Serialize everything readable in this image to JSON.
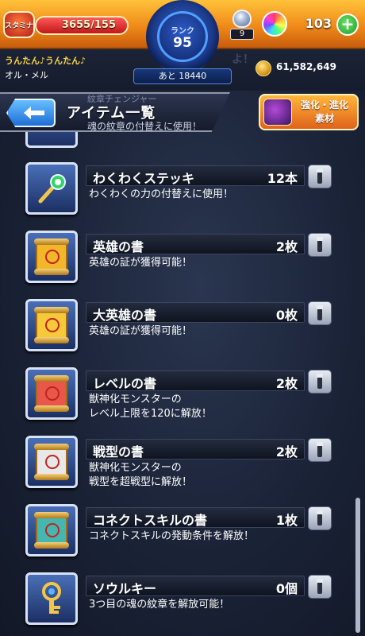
{
  "status": {
    "stamina_label": "スタミナ",
    "stamina_text": "3655/155",
    "stamina_fraction": 1.0,
    "rank_label": "ランク",
    "rank_value": "95",
    "rank_next": "あと 18440",
    "potion_count": "9",
    "orb_count": "103",
    "coins": "61,582,649"
  },
  "user": {
    "name": "うんたん♪うんたん♪",
    "sub": "オル・メル",
    "ghost_text": "よ！"
  },
  "header": {
    "title": "アイテム一覧",
    "ghost_title": "紋章チェンジャー",
    "ghost_desc": "魂の紋章の付替えに使用！",
    "evolve_button": "強化・進化\n素材"
  },
  "items": [
    {
      "name": "わくわくステッキ",
      "count": "12本",
      "desc": "わくわくの力の付替えに使用！",
      "icon": "wand-icon",
      "accent": "#35d46a"
    },
    {
      "name": "英雄の書",
      "count": "2枚",
      "desc": "英雄の証が獲得可能！",
      "icon": "scroll-icon",
      "accent": "#f2b62a"
    },
    {
      "name": "大英雄の書",
      "count": "0枚",
      "desc": "英雄の証が獲得可能！",
      "icon": "scroll-icon",
      "accent": "#f7c83a"
    },
    {
      "name": "レベルの書",
      "count": "2枚",
      "desc": "獣神化モンスターの\nレベル上限を120に解放！",
      "icon": "scroll-icon",
      "accent": "#e8574a"
    },
    {
      "name": "戦型の書",
      "count": "2枚",
      "desc": "獣神化モンスターの\n戦型を超戦型に解放！",
      "icon": "scroll-icon",
      "accent": "#e8e8e8"
    },
    {
      "name": "コネクトスキルの書",
      "count": "1枚",
      "desc": "コネクトスキルの発動条件を解放！",
      "icon": "scroll-icon",
      "accent": "#46b7b0"
    },
    {
      "name": "ソウルキー",
      "count": "0個",
      "desc": "3つ目の魂の紋章を解放可能！",
      "icon": "key-icon",
      "accent": "#d8e2f5"
    }
  ]
}
